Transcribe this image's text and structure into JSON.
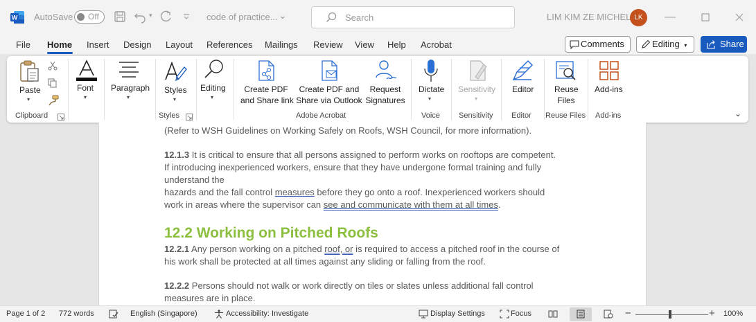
{
  "titlebar": {
    "autosave_label": "AutoSave",
    "autosave_state": "Off",
    "doc_title": "code of practice...",
    "search_placeholder": "Search",
    "user_name": "LIM KIM ZE MICHELL",
    "user_initials": "LK"
  },
  "menu": {
    "tabs": [
      "File",
      "Home",
      "Insert",
      "Design",
      "Layout",
      "References",
      "Mailings",
      "Review",
      "View",
      "Help",
      "Acrobat"
    ],
    "active": "Home",
    "comments": "Comments",
    "editing": "Editing",
    "share": "Share"
  },
  "ribbon": {
    "paste": "Paste",
    "clipboard": "Clipboard",
    "font": "Font",
    "paragraph": "Paragraph",
    "styles": "Styles",
    "styles_group": "Styles",
    "editing": "Editing",
    "create_pdf_1": "Create PDF",
    "create_pdf_2": "and Share link",
    "create_pdf_outlook_1": "Create PDF and",
    "create_pdf_outlook_2": "Share via Outlook",
    "request_sig_1": "Request",
    "request_sig_2": "Signatures",
    "adobe_group": "Adobe Acrobat",
    "dictate": "Dictate",
    "voice_group": "Voice",
    "sensitivity": "Sensitivity",
    "sensitivity_group": "Sensitivity",
    "editor": "Editor",
    "editor_group": "Editor",
    "reuse_1": "Reuse",
    "reuse_2": "Files",
    "reuse_group": "Reuse Files",
    "addins": "Add-ins",
    "addins_group": "Add-ins"
  },
  "document": {
    "line_ref": "(Refer to WSH Guidelines on Working Safely on Roofs, WSH Council, for more information).",
    "p1_num": "12.1.3",
    "p1_a": " It is critical to ensure that all persons assigned to perform works on rooftops are competent.",
    "p1_b": "If introducing inexperienced workers, ensure that they have undergone formal training and fully",
    "p1_c": "understand the",
    "p1_d1": "hazards and the fall control ",
    "p1_d2": "measures",
    "p1_d3": " before they go onto a roof. Inexperienced workers should",
    "p1_e1": "work in areas where the supervisor can ",
    "p1_e2": "see and communicate with them at all times",
    "p1_e3": ".",
    "heading": "12.2 Working on Pitched Roofs",
    "p2_num": "12.2.1",
    "p2_a1": " Any person working on a pitched ",
    "p2_a2": "roof, or",
    "p2_a3": " is required to access a pitched roof in the course of",
    "p2_b": "his work shall be protected at all times against any sliding or falling from the roof.",
    "p3_num": "12.2.2",
    "p3_a": " Persons should not walk or work directly on tiles or slates unless additional fall control",
    "p3_b": "measures are in place."
  },
  "status": {
    "page": "Page 1 of 2",
    "words": "772 words",
    "language": "English (Singapore)",
    "accessibility": "Accessibility: Investigate",
    "display_settings": "Display Settings",
    "focus": "Focus",
    "zoom": "100%"
  }
}
